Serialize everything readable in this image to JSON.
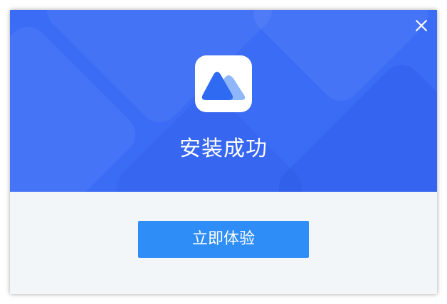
{
  "dialog": {
    "title": "安装成功",
    "primary_button_label": "立即体验",
    "close_icon": "close-icon",
    "app_icon": "app-logo-icon"
  },
  "colors": {
    "banner": "#3b6cf6",
    "button": "#2e8df7",
    "footer_bg": "#f3f6f8",
    "logo_dark": "#2f6af2",
    "logo_light": "#8fb6f8"
  }
}
